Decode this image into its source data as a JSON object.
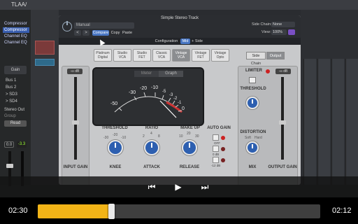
{
  "daw": {
    "track_title": "TLAA/",
    "plugin_slots": [
      {
        "label": "Compressor",
        "selected": false
      },
      {
        "label": "Compressor",
        "selected": true
      },
      {
        "label": "Channel EQ",
        "selected": false
      },
      {
        "label": "Channel EQ",
        "selected": false
      }
    ],
    "gain_label": "Gain",
    "sends": [
      "Bus 1",
      "Bus 2",
      "> SD3",
      "> SD4"
    ],
    "output": "Stereo Out",
    "group": "Group",
    "automation": "Read",
    "level_left": "0.0",
    "level_right": "-3.3"
  },
  "plugin": {
    "window_title": "Simple Stereo Track",
    "preset": "Manual",
    "nav_prev": "<",
    "nav_next": ">",
    "compare": "Compare",
    "copy": "Copy",
    "paste": "Paste",
    "side_chain_label": "Side Chain:",
    "side_chain_value": "None",
    "view_label": "View:",
    "view_value": "100%",
    "config_label": "Configuration",
    "config_options": [
      "Mid",
      "+ Side"
    ],
    "models": [
      {
        "line1": "Platinum",
        "line2": "Digital",
        "selected": false
      },
      {
        "line1": "Studio",
        "line2": "VCA",
        "selected": false
      },
      {
        "line1": "Studio",
        "line2": "FET",
        "selected": false
      },
      {
        "line1": "Classic",
        "line2": "VCA",
        "selected": false
      },
      {
        "line1": "Vintage",
        "line2": "VCA",
        "selected": true
      },
      {
        "line1": "Vintage",
        "line2": "FET",
        "selected": false
      },
      {
        "line1": "Vintage",
        "line2": "Opto",
        "selected": false
      }
    ],
    "side_chain_btn": "Side Chain",
    "output_btn": "Output",
    "meter_tabs": [
      "Meter",
      "Graph"
    ],
    "meter_scale": [
      "-50",
      "-30",
      "-20",
      "-10",
      "-5",
      "-3",
      "-2",
      "-1",
      "0"
    ],
    "input_db": "-∞ dB",
    "output_db": "-∞ dB",
    "limiter": "LIMITER",
    "threshold": "THRESHOLD",
    "ratio": "RATIO",
    "makeup": "MAKE UP",
    "auto_gain": "AUTO GAIN",
    "auto_gain_options": [
      "OFF",
      "0 dB",
      "-12 dB"
    ],
    "knee": "KNEE",
    "attack": "ATTACK",
    "release": "RELEASE",
    "input_gain": "INPUT GAIN",
    "distortion": "DISTORTION",
    "distortion_options": [
      "Soft",
      "Hard"
    ],
    "mix": "MIX",
    "output_gain": "OUTPUT GAIN",
    "thr_scale": [
      "-30",
      "-20",
      "-10"
    ],
    "ratio_scale": [
      "2",
      "4",
      "8"
    ],
    "makeup_scale": [
      "10",
      "20",
      "30"
    ]
  },
  "video": {
    "elapsed": "02:30",
    "remaining": "02:12",
    "progress": 0.26,
    "controls": {
      "prev": "⏮",
      "play": "▶",
      "next": "⏭"
    }
  },
  "colors": {
    "accent_blue": "#2d5fb0",
    "progress_fill": "#f2b417",
    "led_red": "#cc2222"
  }
}
